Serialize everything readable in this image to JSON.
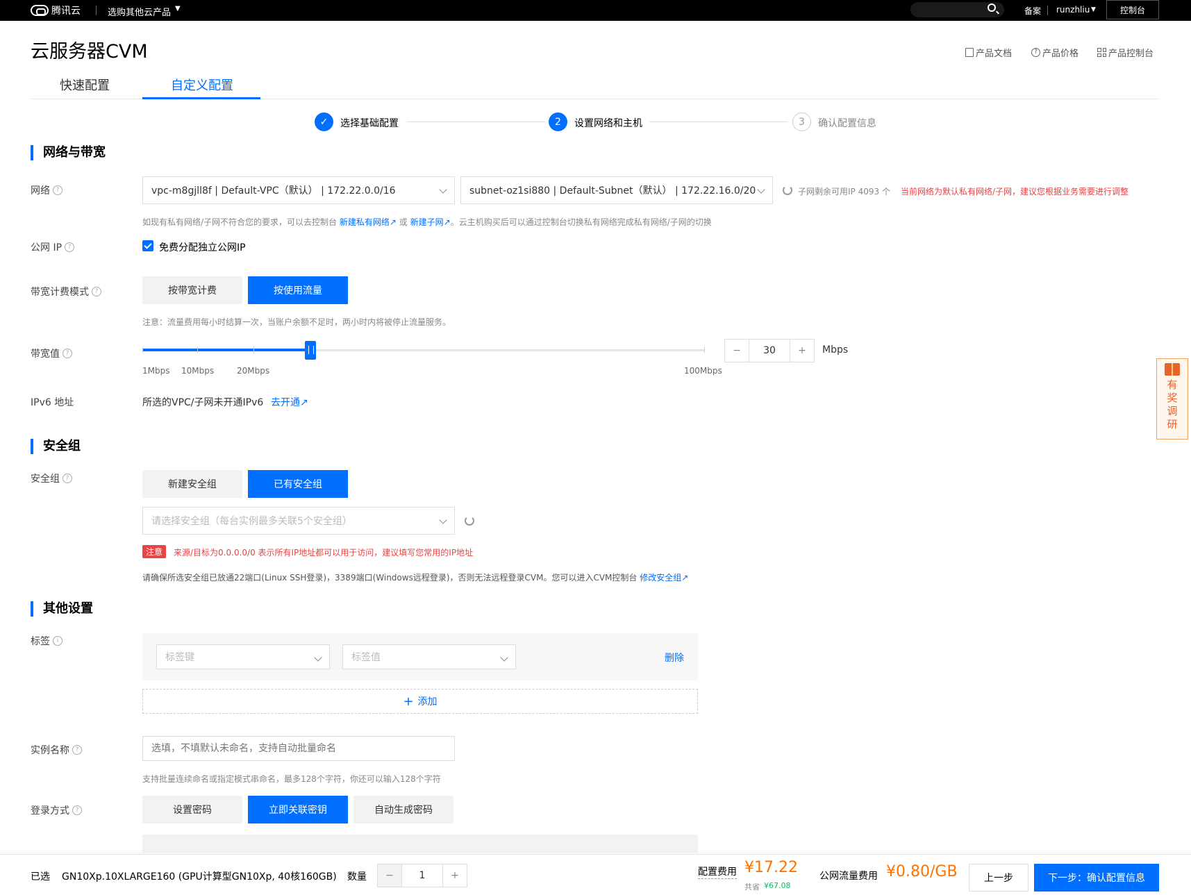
{
  "topbar": {
    "logo_text": "腾讯云",
    "products": "选购其他云产品",
    "beian": "备案",
    "user": "runzhliu",
    "console": "控制台"
  },
  "header": {
    "title": "云服务器CVM",
    "doc": "产品文档",
    "price": "产品价格",
    "console": "产品控制台"
  },
  "tabs": [
    {
      "label": "快速配置"
    },
    {
      "label": "自定义配置",
      "active": true
    }
  ],
  "steps": [
    {
      "num": "✓",
      "label": "选择基础配置",
      "state": "done"
    },
    {
      "num": "2",
      "label": "设置网络和主机",
      "state": "active"
    },
    {
      "num": "3",
      "label": "确认配置信息",
      "state": "pending"
    }
  ],
  "network": {
    "section_title": "网络与带宽",
    "label": "网络",
    "vpc": "vpc-m8gjll8f | Default-VPC（默认） | 172.22.0.0/16",
    "subnet": "subnet-oz1si880 | Default-Subnet（默认） | 172.22.16.0/20",
    "ip_remaining": "子网剩余可用IP 4093 个",
    "warning": "当前网络为默认私有网络/子网，建议您根据业务需要进行调整",
    "hint_prefix": "如现有私有网络/子网不符合您的要求，可以去控制台",
    "hint_link1": "新建私有网络",
    "hint_or": "或",
    "hint_link2": "新建子网",
    "hint_suffix": "。云主机购买后可以通过控制台切换私有网络完成私有网络/子网的切换",
    "public_ip_label": "公网 IP",
    "public_ip_check": "免费分配独立公网IP",
    "billing_label": "带宽计费模式",
    "billing_opt1": "按带宽计费",
    "billing_opt2": "按使用流量",
    "billing_note": "注意：流量费用每小时结算一次，当账户余额不足时，两小时内将被停止流量服务。",
    "bw_label": "带宽值",
    "bw_value": "30",
    "bw_unit": "Mbps",
    "bw_fraction": 0.3,
    "bw_ticks": [
      "1Mbps",
      "10Mbps",
      "20Mbps",
      "100Mbps"
    ],
    "minus": "−",
    "plus": "+",
    "ipv6_label": "IPv6 地址",
    "ipv6_text": "所选的VPC/子网未开通IPv6",
    "ipv6_link": "去开通"
  },
  "security": {
    "section_title": "安全组",
    "label": "安全组",
    "opt1": "新建安全组",
    "opt2": "已有安全组",
    "placeholder": "请选择安全组（每台实例最多关联5个安全组）",
    "notice_tag": "注意",
    "notice": "来源/目标为0.0.0.0/0 表示所有IP地址都可以用于访问，建议填写您常用的IP地址",
    "info": "请确保所选安全组已放通22端口(Linux SSH登录)，3389端口(Windows远程登录)，否则无法远程登录CVM。您可以进入CVM控制台",
    "info_link": "修改安全组"
  },
  "other": {
    "section_title": "其他设置",
    "tag_label": "标签",
    "tag_key": "标签键",
    "tag_value": "标签值",
    "delete": "删除",
    "add": "添加",
    "name_label": "实例名称",
    "name_placeholder": "选填，不填默认未命名，支持自动批量命名",
    "name_hint": "支持批量连续命名或指定模式串命名，最多128个字符，你还可以输入128个字符",
    "login_label": "登录方式",
    "login_opt1": "设置密码",
    "login_opt2": "立即关联密钥",
    "login_opt3": "自动生成密码"
  },
  "survey": {
    "text": "有奖调研"
  },
  "bottom": {
    "selected_label": "已选",
    "selected": "GN10Xp.10XLARGE160 (GPU计算型GN10Xp, 40核160GB)",
    "qty_label": "数量",
    "qty": "1",
    "config_fee_label": "配置费用",
    "config_fee": "¥17.22",
    "saving_label": "共省",
    "saving": "¥67.08",
    "traffic_label": "公网流量费用",
    "traffic_fee": "¥0.80/GB",
    "prev": "上一步",
    "next": "下一步：确认配置信息"
  }
}
